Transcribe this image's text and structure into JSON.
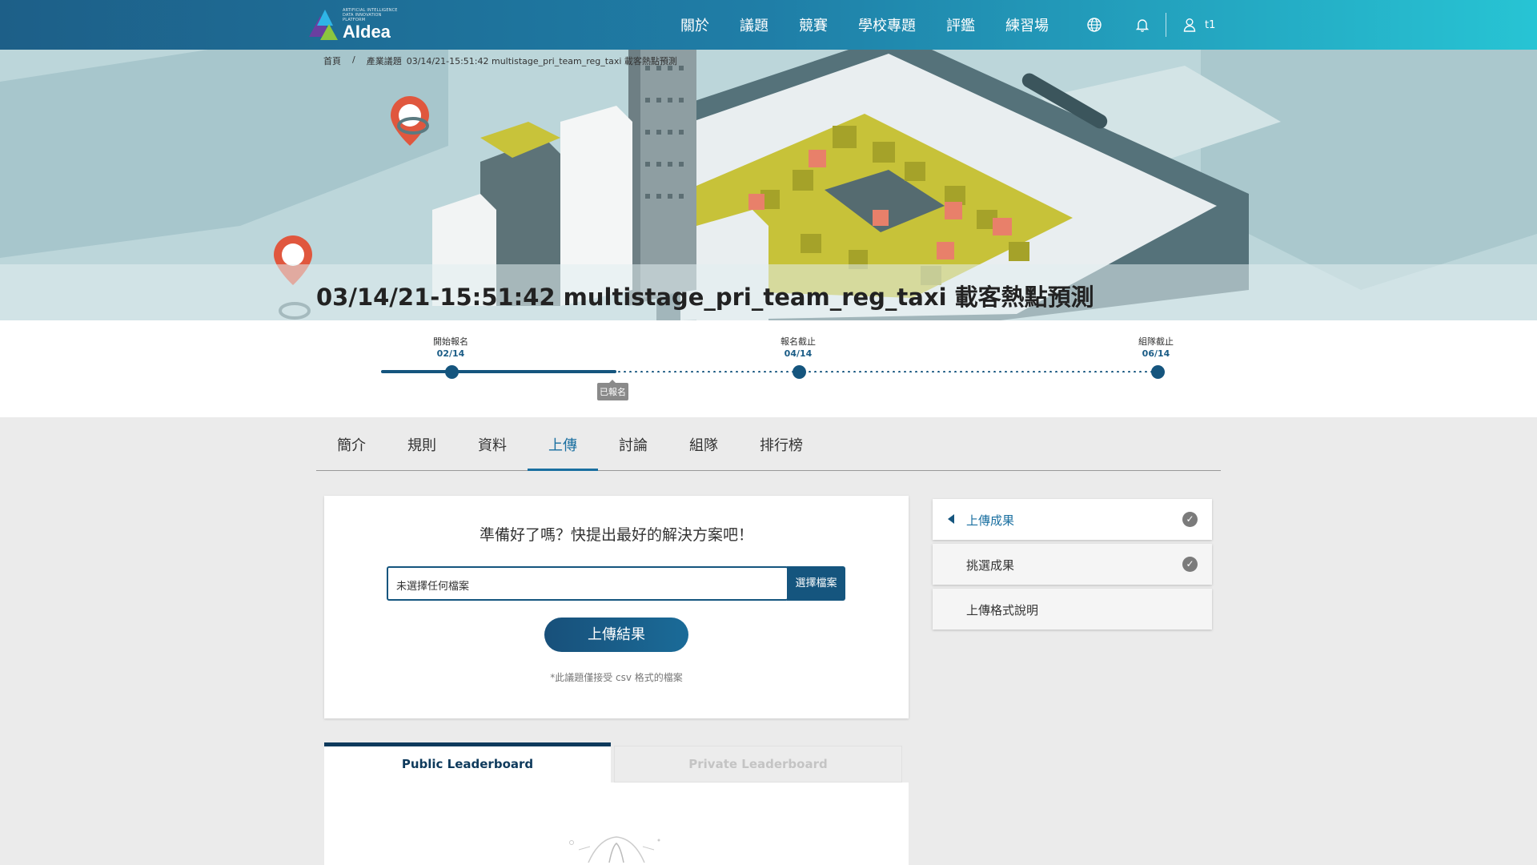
{
  "header": {
    "logo_small_text": "ARTIFICIAL INTELLIGENCE DATA INNOVATION PLATFORM",
    "logo_text": "AIdea",
    "nav": [
      "關於",
      "議題",
      "競賽",
      "學校專題",
      "評鑑",
      "練習場"
    ],
    "user_name": "t1"
  },
  "breadcrumb": {
    "home": "首頁",
    "sep": "/",
    "section": "產業議題",
    "current": "03/14/21-15:51:42 multistage_pri_team_reg_taxi 載客熱點預測"
  },
  "page_title": "03/14/21-15:51:42 multistage_pri_team_reg_taxi 載客熱點預測",
  "timeline": {
    "milestones": [
      {
        "label": "開始報名",
        "date": "02/14"
      },
      {
        "label": "報名截止",
        "date": "04/14"
      },
      {
        "label": "組隊截止",
        "date": "06/14"
      }
    ],
    "status_badge": "已報名"
  },
  "tabs": [
    "簡介",
    "規則",
    "資料",
    "上傳",
    "討論",
    "組隊",
    "排行榜"
  ],
  "active_tab": "上傳",
  "upload": {
    "heading": "準備好了嗎？快提出最好的解決方案吧！",
    "file_placeholder": "未選擇任何檔案",
    "choose_file_label": "選擇檔案",
    "submit_label": "上傳結果",
    "note": "*此議題僅接受 csv 格式的檔案"
  },
  "side_menu": [
    {
      "label": "上傳成果",
      "active": true,
      "checked": true
    },
    {
      "label": "挑選成果",
      "active": false,
      "checked": true
    },
    {
      "label": "上傳格式說明",
      "active": false,
      "checked": false
    }
  ],
  "leaderboard": {
    "public_tab": "Public Leaderboard",
    "private_tab": "Private Leaderboard"
  },
  "colors": {
    "primary": "#15557e",
    "accent": "#1a6fa0",
    "header_start": "#1d5f88",
    "header_end": "#27c4d4"
  }
}
